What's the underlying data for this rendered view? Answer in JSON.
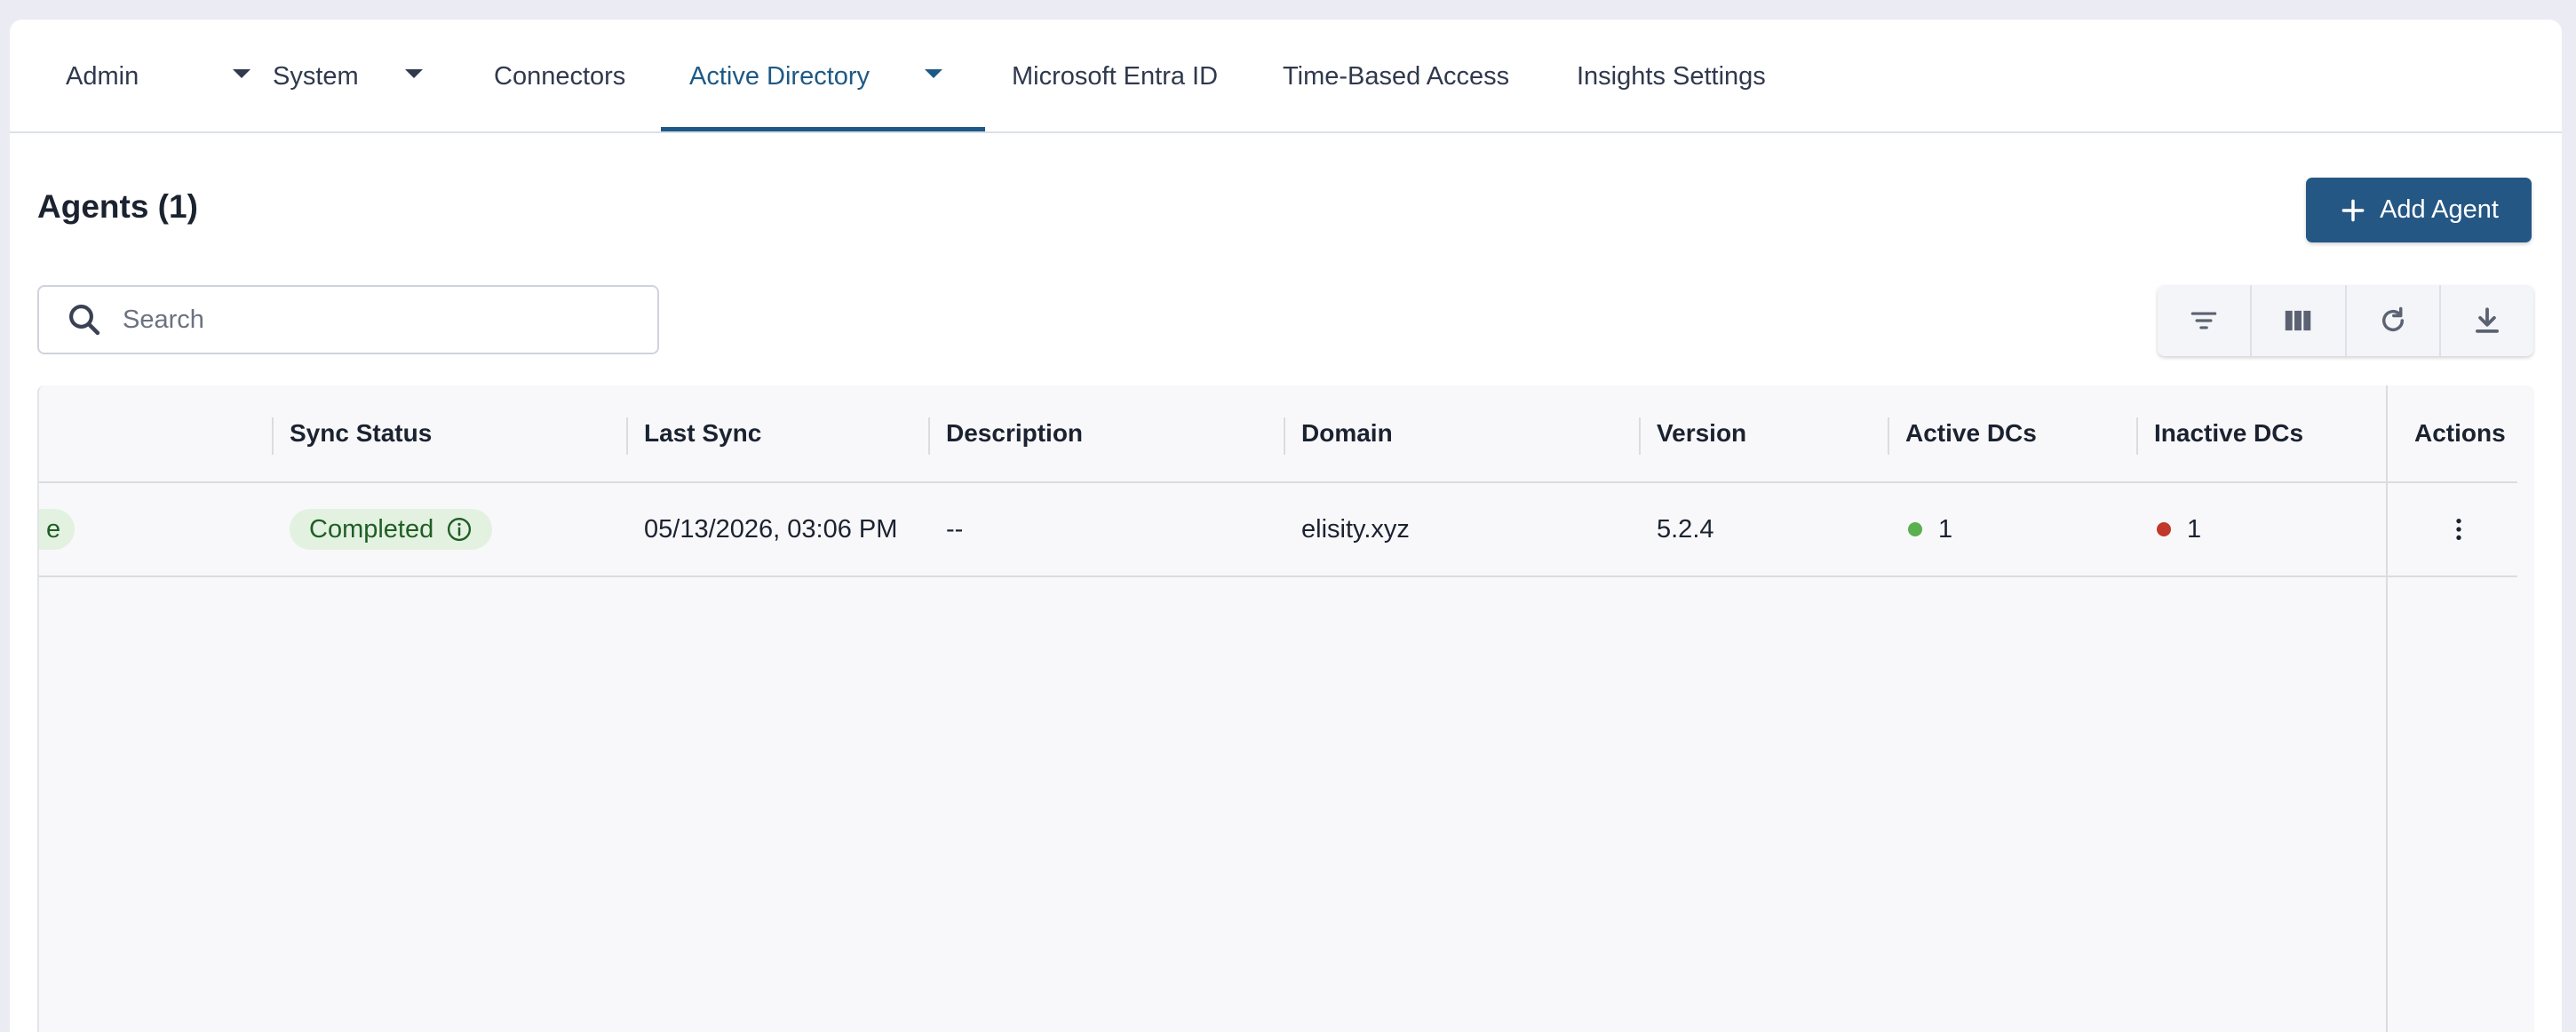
{
  "nav": {
    "tabs": [
      {
        "label": "Admin",
        "has_dropdown": true,
        "active": false
      },
      {
        "label": "System",
        "has_dropdown": true,
        "active": false
      },
      {
        "label": "Connectors",
        "has_dropdown": false,
        "active": false
      },
      {
        "label": "Active Directory",
        "has_dropdown": true,
        "active": true
      },
      {
        "label": "Microsoft Entra ID",
        "has_dropdown": false,
        "active": false
      },
      {
        "label": "Time-Based Access",
        "has_dropdown": false,
        "active": false
      },
      {
        "label": "Insights Settings",
        "has_dropdown": false,
        "active": false
      }
    ]
  },
  "header": {
    "title": "Agents (1)",
    "add_button_label": "Add Agent"
  },
  "search": {
    "placeholder": "Search",
    "value": ""
  },
  "toolbar": {
    "buttons": [
      "filter-icon",
      "columns-icon",
      "refresh-icon",
      "download-icon"
    ]
  },
  "table": {
    "columns": [
      "",
      "Sync Status",
      "Last Sync",
      "Description",
      "Domain",
      "Version",
      "Active DCs",
      "Inactive DCs",
      "Actions"
    ],
    "rows": [
      {
        "status_partial": "e",
        "sync_status": "Completed",
        "last_sync": "05/13/2026, 03:06 PM",
        "description": "--",
        "domain": "elisity.xyz",
        "version": "5.2.4",
        "active_dcs": "1",
        "inactive_dcs": "1"
      }
    ]
  },
  "colors": {
    "accent": "#1d5986",
    "button": "#245784",
    "chip_bg": "#e3f1e1",
    "chip_text": "#1f5e24",
    "active_dot": "#5aaf50",
    "inactive_dot": "#c0392b"
  }
}
